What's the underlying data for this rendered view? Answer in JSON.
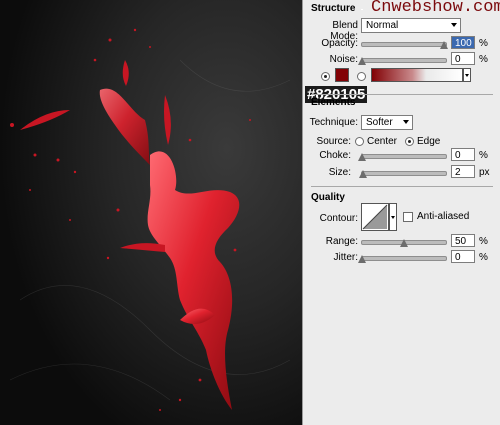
{
  "watermark": "Cnwebshow.com",
  "hex_annotation": "#820105",
  "colors": {
    "swatch": "#820105",
    "accent": "#7b0a0d"
  },
  "structure": {
    "title": "Structure",
    "blend_mode_label": "Blend Mode:",
    "blend_mode_value": "Normal",
    "opacity_label": "Opacity:",
    "opacity_value": "100",
    "opacity_unit": "%",
    "opacity_level": 1.0,
    "noise_label": "Noise:",
    "noise_value": "0",
    "noise_unit": "%",
    "noise_level": 0.0
  },
  "elements": {
    "title": "Elements",
    "technique_label": "Technique:",
    "technique_value": "Softer",
    "source_label": "Source:",
    "source_center": "Center",
    "source_edge": "Edge",
    "choke_label": "Choke:",
    "choke_value": "0",
    "choke_unit": "%",
    "choke_level": 0.0,
    "size_label": "Size:",
    "size_value": "2",
    "size_unit": "px",
    "size_level": 0.01
  },
  "quality": {
    "title": "Quality",
    "contour_label": "Contour:",
    "anti_aliased_label": "Anti-aliased",
    "range_label": "Range:",
    "range_value": "50",
    "range_unit": "%",
    "range_level": 0.5,
    "jitter_label": "Jitter:",
    "jitter_value": "0",
    "jitter_unit": "%",
    "jitter_level": 0.0
  }
}
